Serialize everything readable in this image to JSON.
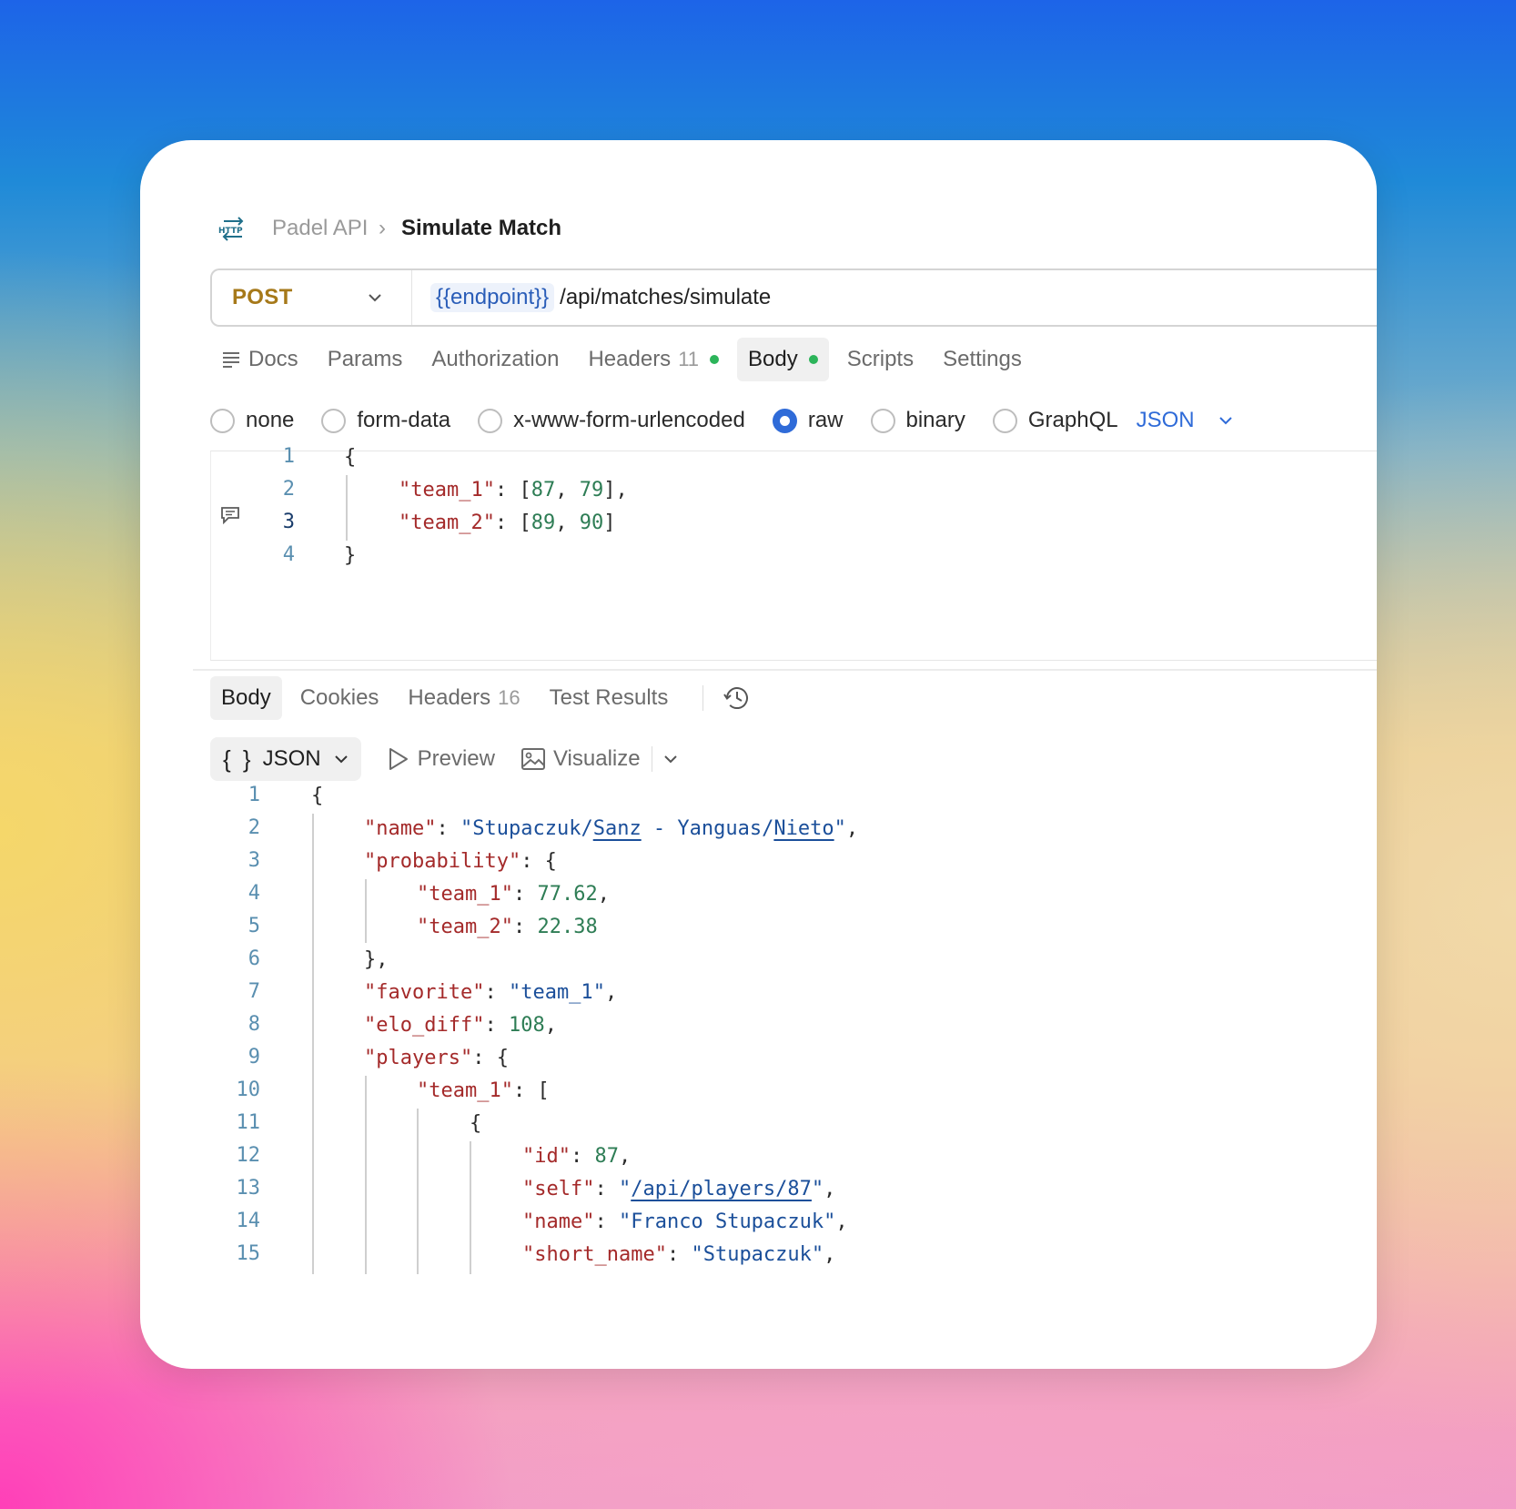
{
  "breadcrumb": {
    "icon": "http-icon",
    "parent": "Padel API",
    "separator": "›",
    "current": "Simulate Match"
  },
  "request": {
    "method": "POST",
    "url_variable": "{{endpoint}}",
    "url_path": "/api/matches/simulate"
  },
  "request_tabs": [
    {
      "label": "Docs",
      "count": "",
      "active": false
    },
    {
      "label": "Params",
      "count": "",
      "active": false
    },
    {
      "label": "Authorization",
      "count": "",
      "active": false
    },
    {
      "label": "Headers",
      "count": "11",
      "active": false
    },
    {
      "label": "Body",
      "count": "",
      "active": true
    },
    {
      "label": "Scripts",
      "count": "",
      "active": false
    },
    {
      "label": "Settings",
      "count": "",
      "active": false
    }
  ],
  "body_modes": [
    "none",
    "form-data",
    "x-www-form-urlencoded",
    "raw",
    "binary",
    "GraphQL"
  ],
  "body_mode_selected": "raw",
  "body_format": "JSON",
  "request_body_lines": [
    "{",
    "\"team_1\": [87, 79],",
    "\"team_2\": [89, 90]",
    "}"
  ],
  "request_line_numbers": [
    "1",
    "2",
    "3",
    "4"
  ],
  "response_tabs": [
    {
      "label": "Body",
      "count": "",
      "active": true
    },
    {
      "label": "Cookies",
      "count": "",
      "active": false
    },
    {
      "label": "Headers",
      "count": "16",
      "active": false
    },
    {
      "label": "Test Results",
      "count": "",
      "active": false
    }
  ],
  "response_toolbar": {
    "format_braces": "{ }",
    "format": "JSON",
    "preview": "Preview",
    "visualize": "Visualize"
  },
  "response_line_numbers": [
    "1",
    "2",
    "3",
    "4",
    "5",
    "6",
    "7",
    "8",
    "9",
    "10",
    "11",
    "12",
    "13",
    "14",
    "15"
  ],
  "response_body": {
    "name": "Stupaczuk/Sanz - Yanguas/Nieto",
    "team_1_probability": "77.62",
    "team_2_probability": "22.38",
    "favorite": "team_1",
    "elo_diff": "108",
    "player_id": "87",
    "player_self": "/api/players/87",
    "player_name": "Franco Stupaczuk",
    "player_short_name": "Stupaczuk"
  },
  "colors": {
    "method": "#a6791a",
    "accent": "#2f6bd8",
    "status_dot": "#2cb45a",
    "json_key": "#a42a2a",
    "json_string": "#1b4f9a",
    "json_number": "#2e7d55"
  }
}
